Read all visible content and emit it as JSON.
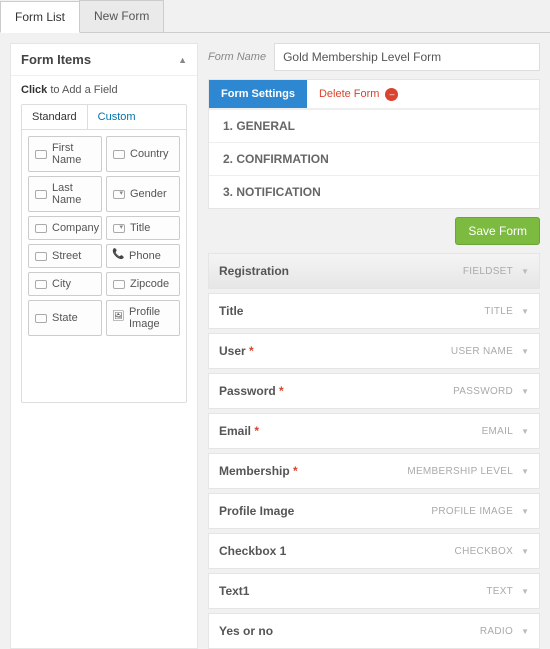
{
  "tabs": {
    "list": "Form List",
    "new": "New Form"
  },
  "side": {
    "title": "Form Items",
    "click_bold": "Click",
    "click_rest": " to Add a Field",
    "subtabs": {
      "standard": "Standard",
      "custom": "Custom"
    },
    "fields": {
      "first_name": "First Name",
      "last_name": "Last Name",
      "company": "Company",
      "street": "Street",
      "city": "City",
      "state": "State",
      "country": "Country",
      "gender": "Gender",
      "title_f": "Title",
      "phone": "Phone",
      "zipcode": "Zipcode",
      "profile_image": "Profile Image"
    }
  },
  "form_name": {
    "label": "Form Name",
    "value": "Gold Membership Level Form"
  },
  "settings": {
    "form_settings": "Form Settings",
    "delete_form": "Delete Form",
    "general": "1. GENERAL",
    "confirmation": "2. CONFIRMATION",
    "notification": "3. NOTIFICATION"
  },
  "save": "Save Form",
  "rows": [
    {
      "label": "Registration",
      "type": "FIELDSET",
      "required": false,
      "fieldset": true
    },
    {
      "label": "Title",
      "type": "TITLE",
      "required": false
    },
    {
      "label": "User",
      "type": "USER NAME",
      "required": true
    },
    {
      "label": "Password",
      "type": "PASSWORD",
      "required": true
    },
    {
      "label": "Email",
      "type": "EMAIL",
      "required": true
    },
    {
      "label": "Membership",
      "type": "MEMBERSHIP LEVEL",
      "required": true
    },
    {
      "label": "Profile Image",
      "type": "PROFILE IMAGE",
      "required": false
    },
    {
      "label": "Checkbox 1",
      "type": "CHECKBOX",
      "required": false
    },
    {
      "label": "Text1",
      "type": "TEXT",
      "required": false
    },
    {
      "label": "Yes or no",
      "type": "RADIO",
      "required": false
    }
  ]
}
